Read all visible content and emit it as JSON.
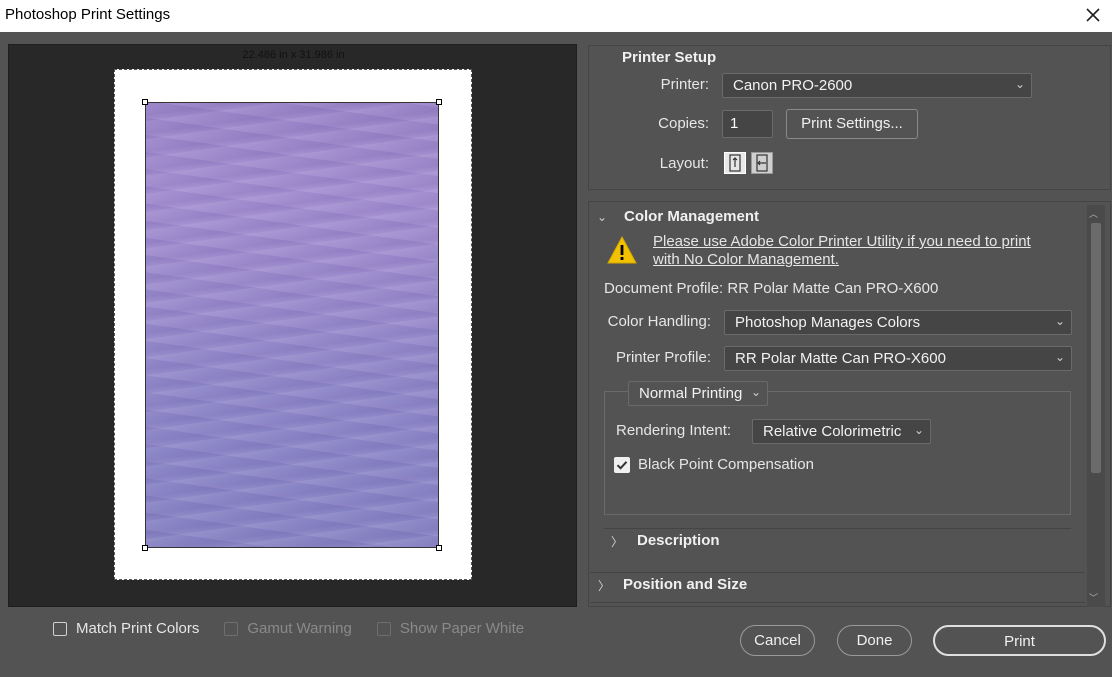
{
  "window": {
    "title": "Photoshop Print Settings"
  },
  "preview": {
    "paper_size": "22.486 in x 31.986 in",
    "options": [
      {
        "label": "Match Print Colors",
        "checked": false,
        "enabled": true
      },
      {
        "label": "Gamut Warning",
        "checked": false,
        "enabled": false
      },
      {
        "label": "Show Paper White",
        "checked": false,
        "enabled": false
      }
    ]
  },
  "printer_setup": {
    "title": "Printer Setup",
    "printer_label": "Printer:",
    "printer_value": "Canon PRO-2600",
    "copies_label": "Copies:",
    "copies_value": "1",
    "print_settings_button": "Print Settings...",
    "layout_label": "Layout:",
    "layout_options": [
      "portrait",
      "landscape"
    ],
    "layout_selected": "portrait"
  },
  "color_management": {
    "title": "Color Management",
    "warning_link": "Please use Adobe Color Printer Utility if you need to print with No Color Management.",
    "document_profile": "Document Profile: RR Polar Matte Can PRO-X600",
    "color_handling_label": "Color Handling:",
    "color_handling_value": "Photoshop Manages Colors",
    "printer_profile_label": "Printer Profile:",
    "printer_profile_value": "RR Polar Matte Can PRO-X600",
    "mode_value": "Normal Printing",
    "rendering_intent_label": "Rendering Intent:",
    "rendering_intent_value": "Relative Colorimetric",
    "bpc_label": "Black Point Compensation",
    "bpc_checked": true
  },
  "sections": {
    "description": "Description",
    "position_size": "Position and Size"
  },
  "footer": {
    "cancel": "Cancel",
    "done": "Done",
    "print": "Print"
  },
  "colors": {
    "dialog_bg": "#535353",
    "preview_bg": "#282828",
    "image_tint": "#9a8ccc"
  }
}
